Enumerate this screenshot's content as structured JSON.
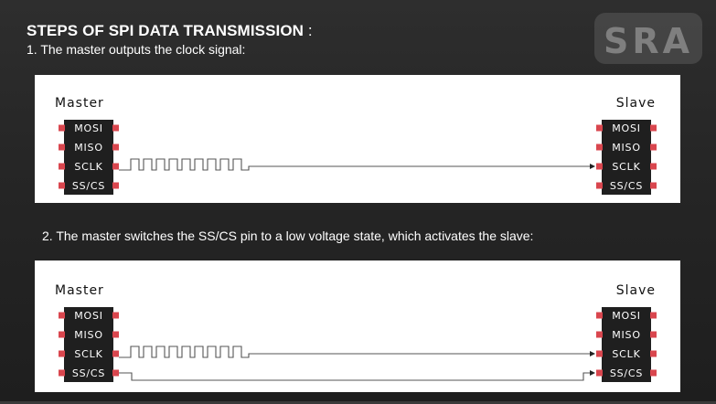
{
  "header": {
    "title": "STEPS OF SPI DATA TRANSMISSION",
    "title_suffix": " :",
    "step1": "1. The master outputs the clock signal:",
    "step2": "2. The master switches the SS/CS pin to a low voltage state, which activates the slave:"
  },
  "logo": {
    "text": "SRA"
  },
  "diagram1": {
    "master_label": "Master",
    "slave_label": "Slave",
    "master_pins": [
      "MOSI",
      "MISO",
      "SCLK",
      "SS/CS"
    ],
    "slave_pins": [
      "MOSI",
      "MISO",
      "SCLK",
      "SS/CS"
    ],
    "active_lines": [
      "SCLK"
    ],
    "clock_line": "SCLK"
  },
  "diagram2": {
    "master_label": "Master",
    "slave_label": "Slave",
    "master_pins": [
      "MOSI",
      "MISO",
      "SCLK",
      "SS/CS"
    ],
    "slave_pins": [
      "MOSI",
      "MISO",
      "SCLK",
      "SS/CS"
    ],
    "active_lines": [
      "SCLK",
      "SS/CS"
    ],
    "clock_line": "SCLK",
    "low_line": "SS/CS"
  },
  "colors": {
    "chip": "#1f1f1f",
    "pin": "#d9464e",
    "wire": "#555555"
  }
}
